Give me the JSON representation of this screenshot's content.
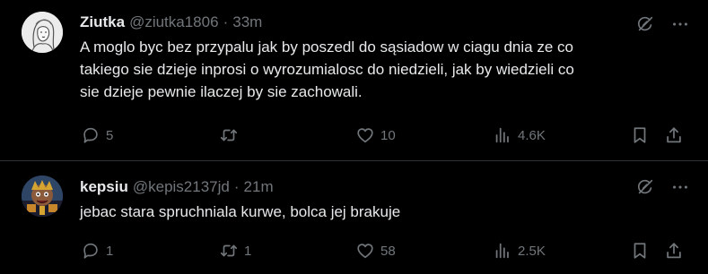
{
  "tweets": [
    {
      "display_name": "Ziutka",
      "handle": "@ziutka1806",
      "separator": "·",
      "time": "33m",
      "text": "A moglo byc bez przypalu jak by poszedl do sąsiadow w ciagu dnia ze co\ntakiego sie dzieje inprosi o wyrozumialosc do niedzieli, jak by wiedzieli co\nsie dzieje pewnie ilaczej by sie zachowali.",
      "replies": "5",
      "retweets": "",
      "likes": "10",
      "views": "4.6K"
    },
    {
      "display_name": "kepsiu",
      "handle": "@kepis2137jd",
      "separator": "·",
      "time": "21m",
      "text": "jebac stara spruchniala kurwe, bolca jej brakuje",
      "replies": "1",
      "retweets": "1",
      "likes": "58",
      "views": "2.5K"
    }
  ],
  "icons": {
    "reply": "reply-icon",
    "retweet": "retweet-icon",
    "like": "like-icon",
    "views": "views-icon",
    "bookmark": "bookmark-icon",
    "share": "share-icon",
    "grok": "grok-icon",
    "more": "more-icon"
  },
  "colors": {
    "background": "#000000",
    "text": "#e7e9ea",
    "secondary": "#71767b",
    "divider": "#2f3336"
  }
}
